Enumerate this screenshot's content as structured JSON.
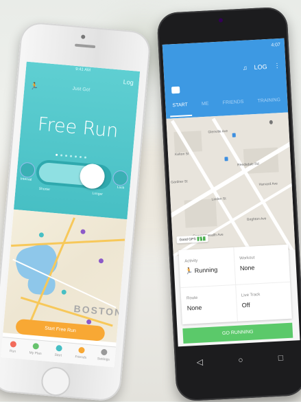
{
  "iphone": {
    "status_time": "9:41 AM",
    "log_label": "Log",
    "subtitle": "Just Go!",
    "title": "Free Run",
    "slider_left_label": "Shorter",
    "slider_right_label": "Longer",
    "left_btn_label": "Interval",
    "right_btn_label": "Lock",
    "map_label": "BOSTON",
    "start_button": "Start Free Run",
    "tabs": [
      {
        "label": "Run",
        "color": "#f26b5b"
      },
      {
        "label": "My Plan",
        "color": "#67c36d"
      },
      {
        "label": "Start",
        "color": "#47bfc4"
      },
      {
        "label": "Friends",
        "color": "#f8a834"
      },
      {
        "label": "Settings",
        "color": "#9a9a9a"
      }
    ]
  },
  "android": {
    "status_time": "4:07",
    "actions": [
      "♫",
      "LOG",
      "⋮"
    ],
    "tabs": [
      {
        "label": "START",
        "selected": true
      },
      {
        "label": "ME",
        "selected": false
      },
      {
        "label": "FRIENDS",
        "selected": false
      },
      {
        "label": "TRAINING",
        "selected": false
      }
    ],
    "streets": [
      "Glenville Ave",
      "Kelton St",
      "Linden St",
      "Commonwealth Ave",
      "Brighton Ave",
      "Harvard Ave",
      "Gardner St",
      "Reedsdale Rd"
    ],
    "gps_label": "Good GPS",
    "cells": [
      {
        "key": "Activity",
        "value": "Running"
      },
      {
        "key": "Workout",
        "value": "None"
      },
      {
        "key": "Route",
        "value": "None"
      },
      {
        "key": "Live Track",
        "value": "Off"
      }
    ],
    "go_button": "GO RUNNING",
    "nav": [
      "◁",
      "○",
      "□"
    ]
  }
}
